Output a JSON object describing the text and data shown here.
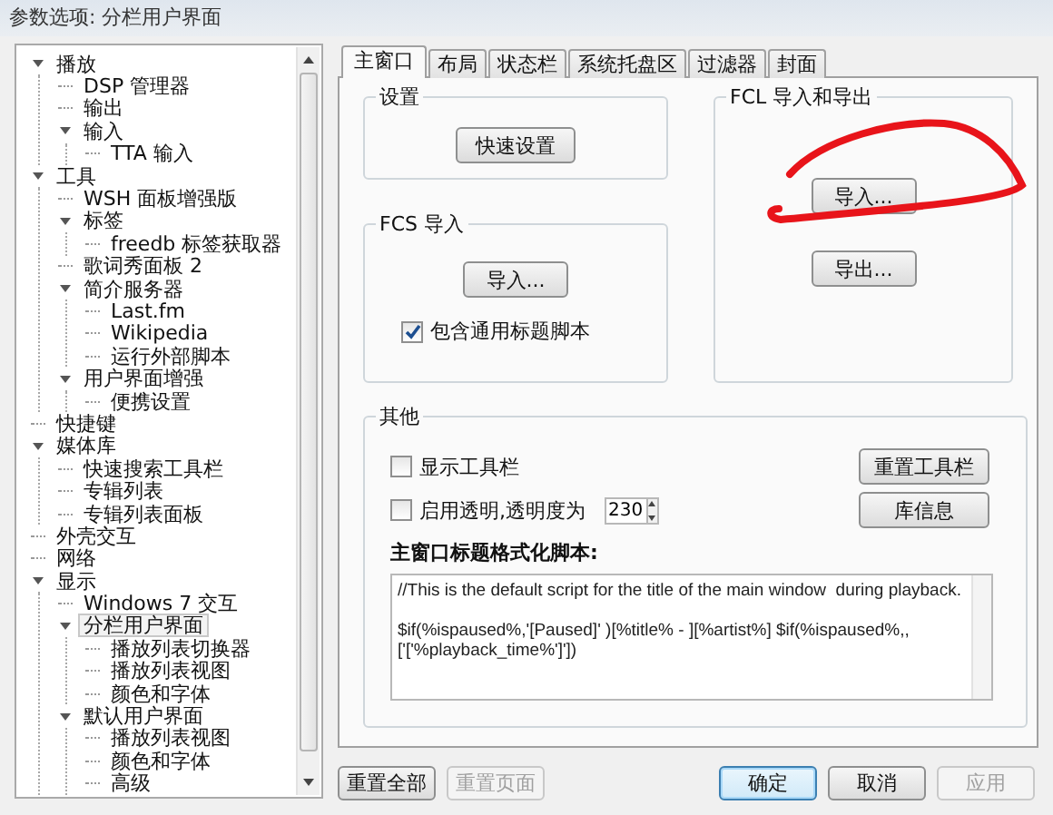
{
  "window": {
    "title": "参数选项: 分栏用户界面"
  },
  "tree": [
    {
      "label": "播放",
      "expanded": true,
      "selected": false,
      "children": [
        {
          "label": "DSP 管理器",
          "selected": false
        },
        {
          "label": "输出",
          "selected": false
        },
        {
          "label": "输入",
          "expanded": true,
          "selected": false,
          "children": [
            {
              "label": "TTA 输入",
              "selected": false
            }
          ]
        }
      ]
    },
    {
      "label": "工具",
      "expanded": true,
      "selected": false,
      "children": [
        {
          "label": "WSH 面板增强版",
          "selected": false
        },
        {
          "label": "标签",
          "expanded": true,
          "selected": false,
          "children": [
            {
              "label": "freedb 标签获取器",
              "selected": false
            }
          ]
        },
        {
          "label": "歌词秀面板 2",
          "selected": false
        },
        {
          "label": "简介服务器",
          "expanded": true,
          "selected": false,
          "children": [
            {
              "label": "Last.fm",
              "selected": false
            },
            {
              "label": "Wikipedia",
              "selected": false
            },
            {
              "label": "运行外部脚本",
              "selected": false
            }
          ]
        },
        {
          "label": "用户界面增强",
          "expanded": true,
          "selected": false,
          "children": [
            {
              "label": "便携设置",
              "selected": false
            }
          ]
        }
      ]
    },
    {
      "label": "快捷键",
      "selected": false
    },
    {
      "label": "媒体库",
      "expanded": true,
      "selected": false,
      "children": [
        {
          "label": "快速搜索工具栏",
          "selected": false
        },
        {
          "label": "专辑列表",
          "selected": false
        },
        {
          "label": "专辑列表面板",
          "selected": false
        }
      ]
    },
    {
      "label": "外壳交互",
      "selected": false
    },
    {
      "label": "网络",
      "selected": false
    },
    {
      "label": "显示",
      "expanded": true,
      "selected": false,
      "children": [
        {
          "label": "Windows 7 交互",
          "selected": false
        },
        {
          "label": "分栏用户界面",
          "expanded": true,
          "selected": true,
          "children": [
            {
              "label": "播放列表切换器",
              "selected": false
            },
            {
              "label": "播放列表视图",
              "selected": false
            },
            {
              "label": "颜色和字体",
              "selected": false
            }
          ]
        },
        {
          "label": "默认用户界面",
          "expanded": true,
          "selected": false,
          "children": [
            {
              "label": "播放列表视图",
              "selected": false
            },
            {
              "label": "颜色和字体",
              "selected": false
            },
            {
              "label": "高级",
              "selected": false
            }
          ]
        }
      ]
    }
  ],
  "tabs": [
    {
      "label": "主窗口",
      "selected": true
    },
    {
      "label": "布局",
      "selected": false
    },
    {
      "label": "状态栏",
      "selected": false
    },
    {
      "label": "系统托盘区",
      "selected": false
    },
    {
      "label": "过滤器",
      "selected": false
    },
    {
      "label": "封面",
      "selected": false
    }
  ],
  "settings_group": {
    "title": "设置",
    "button": "快速设置"
  },
  "fcs_group": {
    "title": "FCS 导入",
    "button": "导入...",
    "checkbox": {
      "label": "包含通用标题脚本",
      "checked": true
    }
  },
  "fcl_group": {
    "title": "FCL 导入和导出",
    "buttons": [
      "导入...",
      "导出..."
    ]
  },
  "other_group": {
    "title": "其他",
    "checkboxes": [
      {
        "label": "显示工具栏",
        "checked": false
      },
      {
        "label": "启用透明,透明度为",
        "checked": false
      }
    ],
    "opacity_value": "230",
    "buttons": [
      "重置工具栏",
      "库信息"
    ],
    "script_label": "主窗口标题格式化脚本:",
    "script": "//This is the default script for the title of the main window  during playback.\n\n$if(%ispaused%,'[Paused]' )[%title% - ][%artist%] $if(%ispaused%,,\n['['%playback_time%']'])"
  },
  "footer_left": [
    {
      "label": "重置全部",
      "disabled": false
    },
    {
      "label": "重置页面",
      "disabled": true
    }
  ],
  "footer_right": [
    {
      "label": "确定",
      "default": true,
      "disabled": false
    },
    {
      "label": "取消",
      "default": false,
      "disabled": false
    },
    {
      "label": "应用",
      "default": false,
      "disabled": true
    }
  ]
}
